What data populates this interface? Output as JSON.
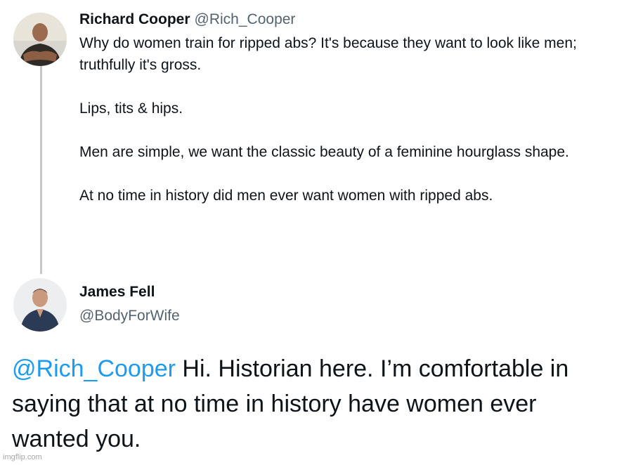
{
  "tweet1": {
    "name": "Richard Cooper",
    "handle": "@Rich_Cooper",
    "paragraphs": [
      "Why do women train for ripped abs?  It's because they want to look like men; truthfully it's gross.",
      "Lips, tits & hips.",
      "Men are simple, we want the classic beauty of a feminine hourglass shape.",
      "At no time in history did men ever want women with ripped abs."
    ]
  },
  "tweet2": {
    "name": "James Fell",
    "handle": "@BodyForWife",
    "reply_mention": "@Rich_Cooper",
    "reply_text": " Hi. Historian here. I’m comfortable in saying that at no time in history have women ever wanted you."
  },
  "watermark": "imgflip.com",
  "colors": {
    "text": "#0f1419",
    "secondary": "#536471",
    "mention": "#1d9bf0",
    "thread_line": "#c4c9ce"
  }
}
